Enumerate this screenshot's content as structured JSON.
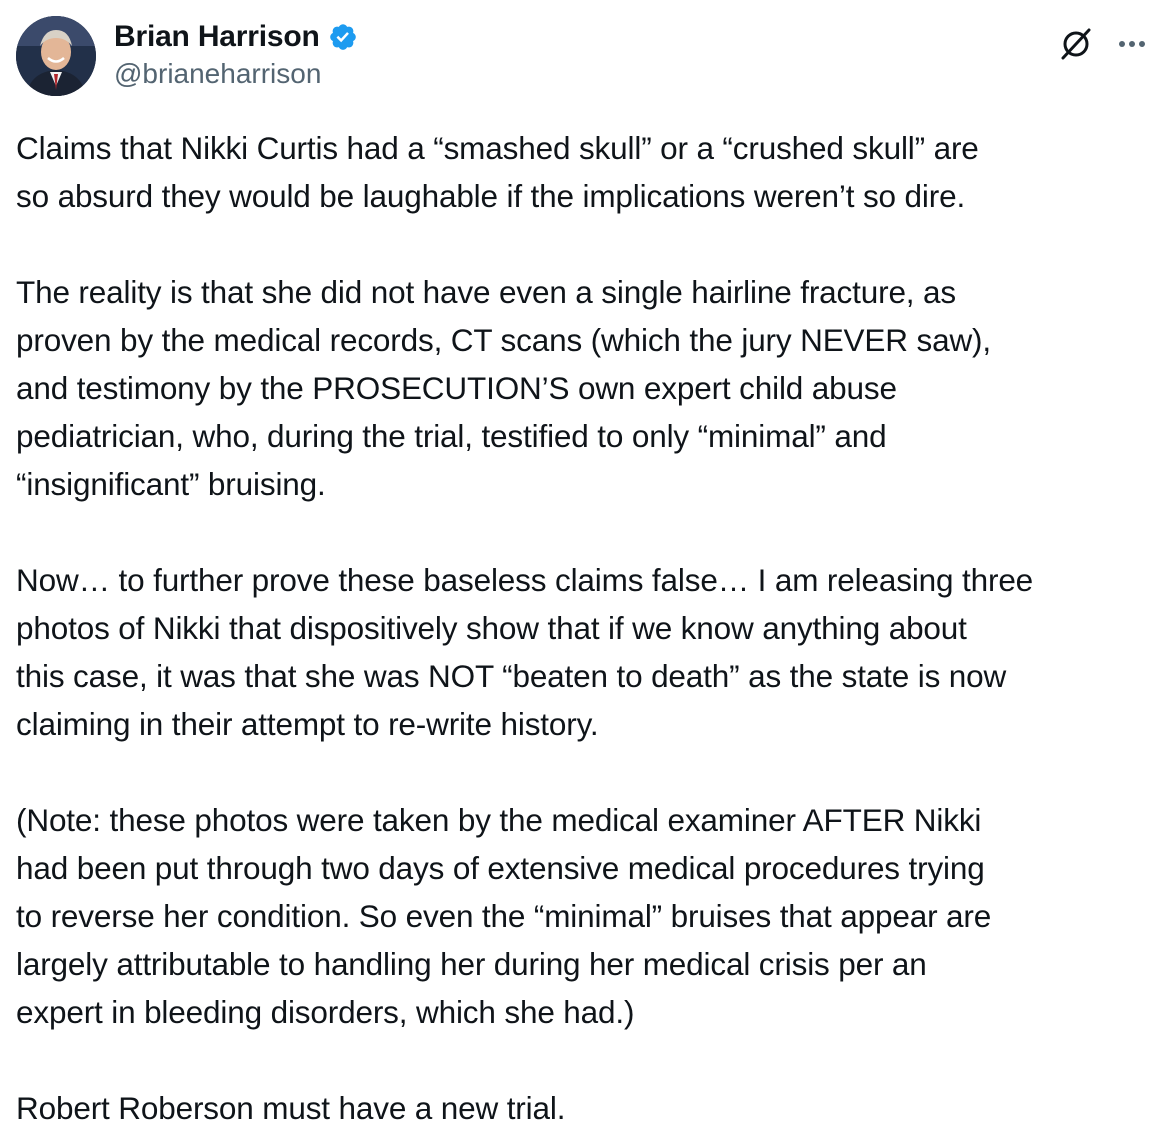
{
  "author": {
    "display_name": "Brian Harrison",
    "handle": "@brianeharrison",
    "verified": true,
    "verified_color": "#1d9bf0"
  },
  "icons": {
    "avatar": "profile-photo",
    "verified": "verified-badge-icon",
    "grok": "grok-slash-icon",
    "more": "more-options-icon"
  },
  "post": {
    "paragraphs": [
      {
        "lines": [
          "Claims that Nikki Curtis had a “smashed skull” or a “crushed skull” are",
          "so absurd they would be laughable if the implications weren’t so dire."
        ]
      },
      {
        "lines": [
          "The reality is that she did not have even a single hairline fracture, as",
          "proven by the medical records, CT scans (which the jury NEVER saw),",
          "and testimony by the PROSECUTION’S own expert child abuse",
          "pediatrician, who, during the trial, testified to only “minimal” and",
          "“insignificant” bruising."
        ]
      },
      {
        "lines": [
          "Now… to further prove these baseless claims false… I am releasing three",
          "photos of Nikki that dispositively show that if we know anything about",
          "this case, it was that she was NOT “beaten to death” as the state is now",
          "claiming in their attempt to re-write history."
        ]
      },
      {
        "lines": [
          "(Note: these photos were taken by the medical examiner AFTER Nikki",
          "had been put through two days of extensive medical procedures trying",
          "to reverse her condition. So even the “minimal” bruises that appear are",
          "largely attributable to handling her during her medical crisis per an",
          "expert in bleeding disorders, which she had.)"
        ]
      },
      {
        "lines": [
          "Robert Roberson must have a new trial."
        ]
      }
    ]
  }
}
